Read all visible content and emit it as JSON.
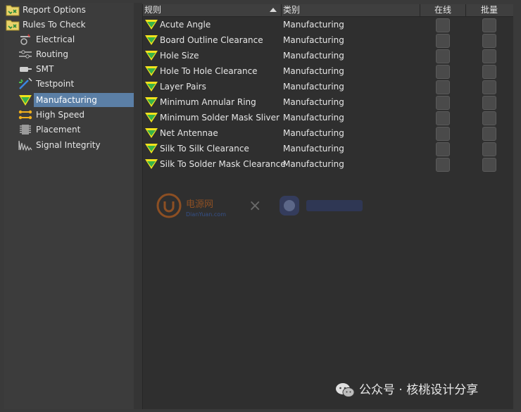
{
  "tree": {
    "items": [
      {
        "label": "Report Options",
        "icon": "folder-check-icon",
        "selected": false
      },
      {
        "label": "Rules To Check",
        "icon": "folder-check-icon",
        "selected": false
      },
      {
        "label": "Electrical",
        "icon": "electrical-icon",
        "selected": false
      },
      {
        "label": "Routing",
        "icon": "routing-icon",
        "selected": false
      },
      {
        "label": "SMT",
        "icon": "smt-icon",
        "selected": false
      },
      {
        "label": "Testpoint",
        "icon": "testpoint-icon",
        "selected": false
      },
      {
        "label": "Manufacturing",
        "icon": "manufacturing-icon",
        "selected": true
      },
      {
        "label": "High Speed",
        "icon": "high-speed-icon",
        "selected": false
      },
      {
        "label": "Placement",
        "icon": "placement-icon",
        "selected": false
      },
      {
        "label": "Signal Integrity",
        "icon": "signal-integrity-icon",
        "selected": false
      }
    ]
  },
  "table": {
    "columns": {
      "rule": "规则",
      "category": "类别",
      "online": "在线",
      "batch": "批量"
    },
    "rows": [
      {
        "rule": "Acute Angle",
        "category": "Manufacturing"
      },
      {
        "rule": "Board Outline Clearance",
        "category": "Manufacturing"
      },
      {
        "rule": "Hole Size",
        "category": "Manufacturing"
      },
      {
        "rule": "Hole To Hole Clearance",
        "category": "Manufacturing"
      },
      {
        "rule": "Layer Pairs",
        "category": "Manufacturing"
      },
      {
        "rule": "Minimum Annular Ring",
        "category": "Manufacturing"
      },
      {
        "rule": "Minimum Solder Mask Sliver",
        "category": "Manufacturing"
      },
      {
        "rule": "Net Antennae",
        "category": "Manufacturing"
      },
      {
        "rule": "Silk To Silk Clearance",
        "category": "Manufacturing"
      },
      {
        "rule": "Silk To Solder Mask Clearance",
        "category": "Manufacturing"
      }
    ]
  },
  "watermark": {
    "site_cn": "电源网",
    "site_en": "DianYuan.com",
    "times": "×"
  },
  "footer": {
    "wechat_text": "公众号 · 核桃设计分享"
  },
  "colors": {
    "selection": "#5b7fa6",
    "background": "#3a3a3a",
    "grid": "#2f2f2f",
    "rule_icon_yellow": "#f2e21b",
    "rule_icon_green": "#38b24a"
  }
}
